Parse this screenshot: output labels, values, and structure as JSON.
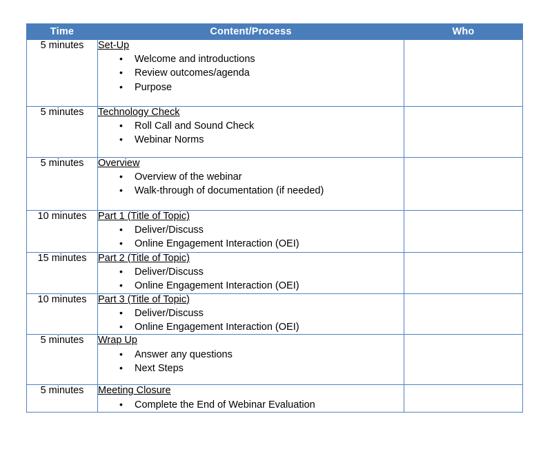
{
  "table": {
    "columns": [
      {
        "key": "time",
        "label": "Time"
      },
      {
        "key": "content",
        "label": "Content/Process"
      },
      {
        "key": "who",
        "label": "Who"
      }
    ],
    "header_bg": "#4A7EBB",
    "header_text_color": "#FFFFFF",
    "border_color": "#4F81BD",
    "rows": [
      {
        "time": "5 minutes",
        "heading": "Set-Up",
        "bullets": [
          "Welcome and introductions",
          "Review outcomes/agenda",
          "Purpose"
        ],
        "who": ""
      },
      {
        "time": "5 minutes",
        "heading": "Technology Check",
        "bullets": [
          "Roll Call and Sound Check",
          "Webinar Norms"
        ],
        "who": ""
      },
      {
        "time": "5 minutes",
        "heading": "Overview",
        "bullets": [
          "Overview of the webinar",
          "Walk-through of documentation (if needed)"
        ],
        "who": ""
      },
      {
        "time": "10 minutes",
        "heading": "Part 1 (Title of Topic)",
        "bullets": [
          "Deliver/Discuss",
          "Online Engagement Interaction (OEI)"
        ],
        "who": ""
      },
      {
        "time": "15 minutes",
        "heading": "Part 2 (Title of Topic)",
        "bullets": [
          "Deliver/Discuss",
          "Online Engagement Interaction (OEI)"
        ],
        "who": ""
      },
      {
        "time": "10 minutes",
        "heading": "Part 3 (Title of Topic)",
        "bullets": [
          "Deliver/Discuss",
          "Online Engagement Interaction (OEI)"
        ],
        "who": ""
      },
      {
        "time": "5 minutes",
        "heading": "Wrap Up",
        "bullets": [
          "Answer any questions",
          "Next Steps"
        ],
        "who": ""
      },
      {
        "time": "5 minutes",
        "heading": "Meeting Closure",
        "bullets": [
          "Complete the End of Webinar Evaluation"
        ],
        "who": ""
      }
    ],
    "bullet_glyph": "•"
  }
}
